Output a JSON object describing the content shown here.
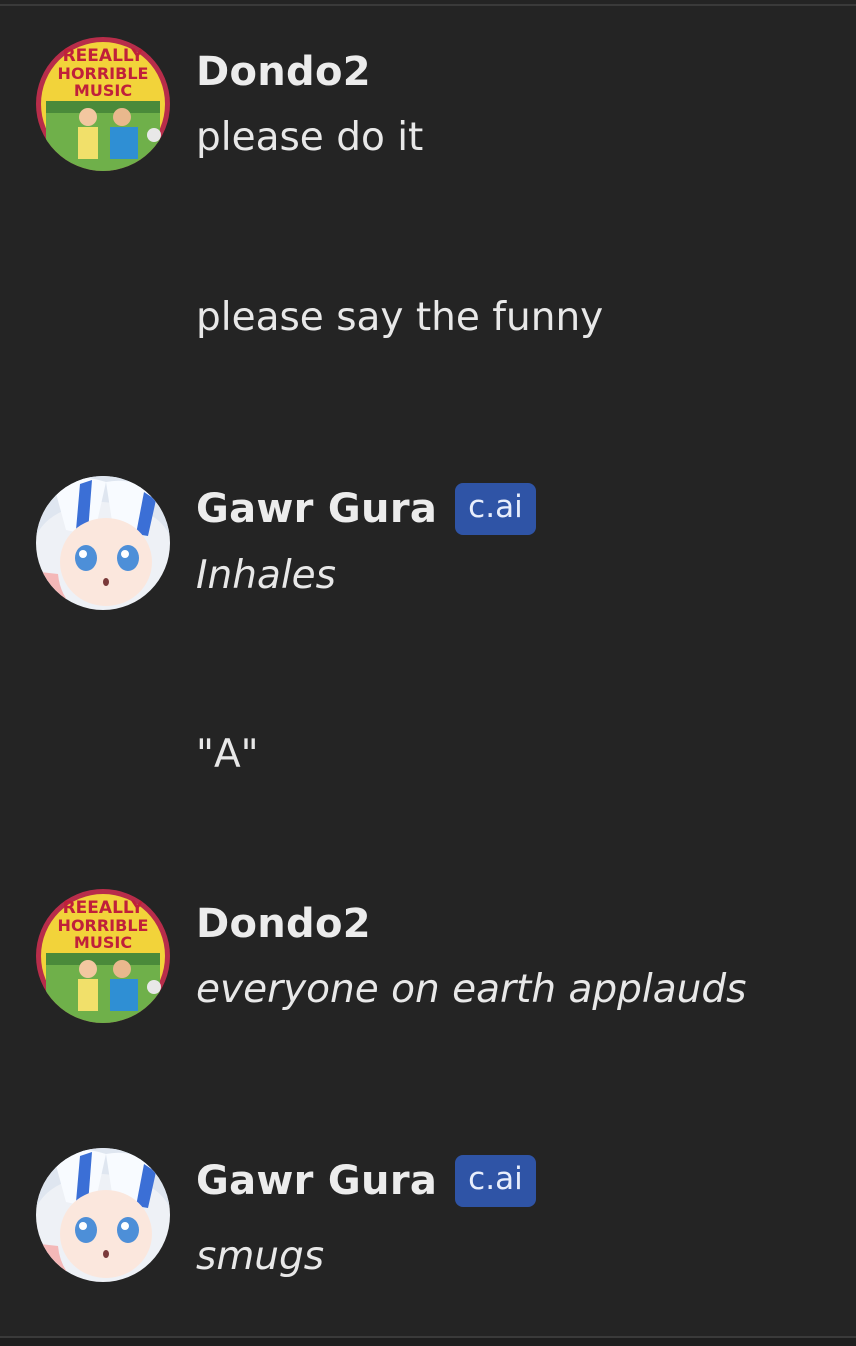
{
  "messages": [
    {
      "author": "Dondo2",
      "avatar": "reeally-horrible-music-avatar",
      "avatar_caption": [
        "REEALLY",
        "HORRIBLE",
        "MUSIC"
      ],
      "lines": [
        {
          "text": "please do it",
          "italic": false
        },
        {
          "text": "please say the funny",
          "italic": false
        }
      ]
    },
    {
      "author": "Gawr Gura",
      "badge": "c.ai",
      "avatar": "gawr-gura-avatar",
      "lines": [
        {
          "text": "Inhales",
          "italic": true
        },
        {
          "text": "\"A\"",
          "italic": false
        }
      ]
    },
    {
      "author": "Dondo2",
      "avatar": "reeally-horrible-music-avatar",
      "avatar_caption": [
        "REEALLY",
        "HORRIBLE",
        "MUSIC"
      ],
      "lines": [
        {
          "text": "everyone on earth applauds",
          "italic": true
        }
      ]
    },
    {
      "author": "Gawr Gura",
      "badge": "c.ai",
      "avatar": "gawr-gura-avatar",
      "lines": [
        {
          "text": "smugs",
          "italic": true
        }
      ]
    }
  ],
  "colors": {
    "background": "#242424",
    "text": "#ececec",
    "badge": "#2f54a6"
  }
}
